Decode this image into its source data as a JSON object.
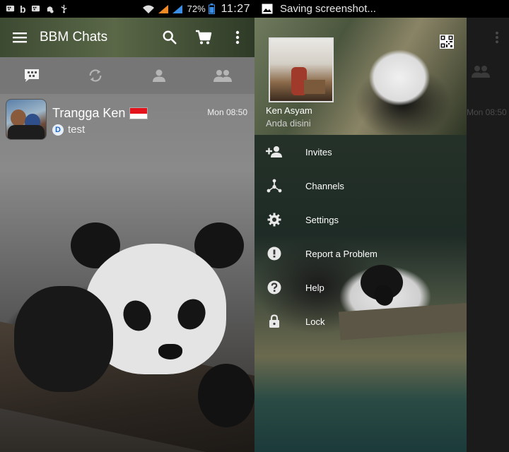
{
  "left": {
    "status_bar": {
      "battery_percent": "72%",
      "time": "11:27"
    },
    "appbar": {
      "title": "BBM Chats"
    },
    "tabs": [
      {
        "name": "chats-tab",
        "icon": "bbm-chat-icon",
        "active": true
      },
      {
        "name": "updates-tab",
        "icon": "sync-icon",
        "active": false
      },
      {
        "name": "contacts-tab",
        "icon": "person-icon",
        "active": false
      },
      {
        "name": "groups-tab",
        "icon": "group-icon",
        "active": false
      }
    ],
    "chats": [
      {
        "name": "Trangga Ken",
        "flag": "indonesia-flag",
        "badge": "D",
        "message": "test",
        "time": "Mon 08:50"
      }
    ]
  },
  "right": {
    "status_bar": {
      "notice": "Saving screenshot..."
    },
    "drawer": {
      "profile_name": "Ken Asyam",
      "profile_status": "Anda disini",
      "menu": [
        {
          "label": "Invites",
          "icon": "add-person-icon"
        },
        {
          "label": "Channels",
          "icon": "channels-icon"
        },
        {
          "label": "Settings",
          "icon": "gear-icon"
        },
        {
          "label": "Report a Problem",
          "icon": "alert-icon"
        },
        {
          "label": "Help",
          "icon": "help-icon"
        },
        {
          "label": "Lock",
          "icon": "lock-icon"
        }
      ]
    },
    "behind": {
      "time": "Mon 08:50"
    }
  },
  "colors": {
    "status_bar_bg": "#000000",
    "signal_orange": "#f08a24",
    "signal_blue": "#3a8ee6",
    "flag_red": "#e3121b",
    "badge_blue": "#1d67c7"
  }
}
